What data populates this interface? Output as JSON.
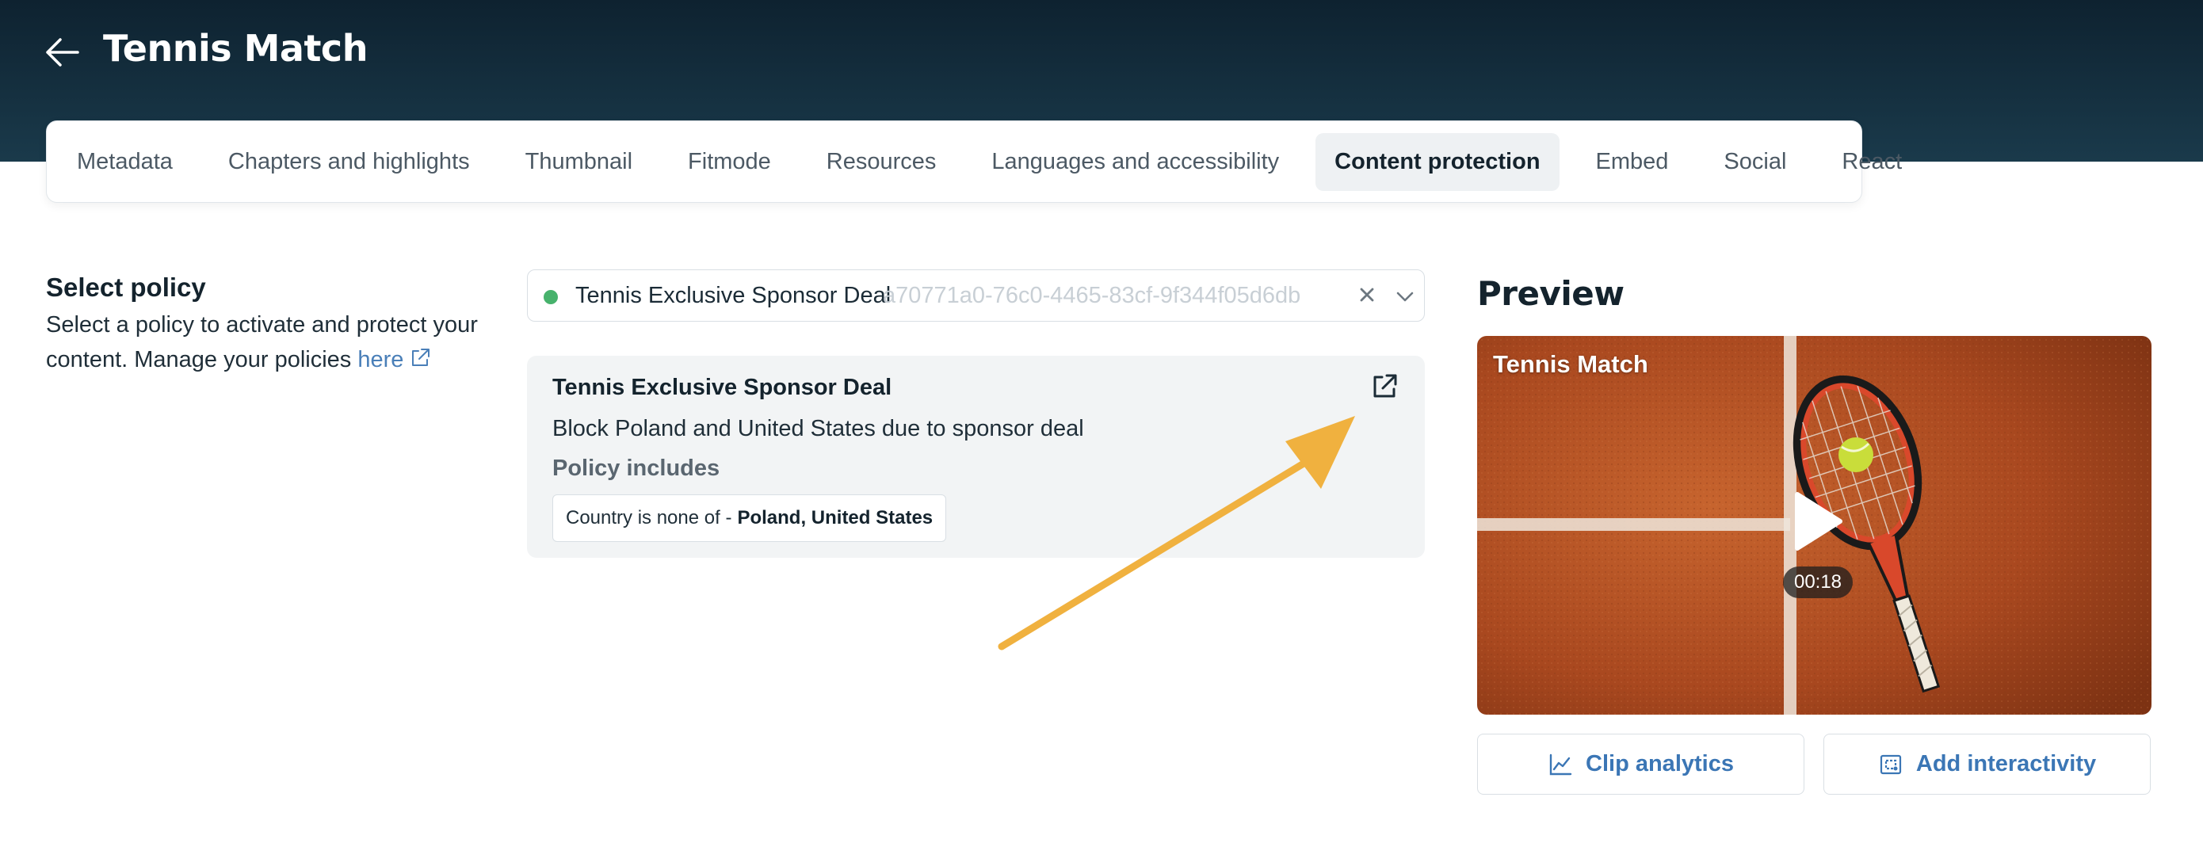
{
  "header": {
    "title": "Tennis Match",
    "back_icon": "arrow-left-icon"
  },
  "tabs": [
    {
      "label": "Metadata",
      "active": false
    },
    {
      "label": "Chapters and highlights",
      "active": false
    },
    {
      "label": "Thumbnail",
      "active": false
    },
    {
      "label": "Fitmode",
      "active": false
    },
    {
      "label": "Resources",
      "active": false
    },
    {
      "label": "Languages and accessibility",
      "active": false
    },
    {
      "label": "Content protection",
      "active": true
    },
    {
      "label": "Embed",
      "active": false
    },
    {
      "label": "Social",
      "active": false
    },
    {
      "label": "React",
      "active": false
    }
  ],
  "select_policy": {
    "title": "Select policy",
    "description": "Select a policy to activate and protect your content. Manage your policies",
    "link_text": "here",
    "link_icon": "external-link-icon"
  },
  "policy_select": {
    "selected_name": "Tennis Exclusive Sponsor Deal",
    "selected_id": "a70771a0-76c0-4465-83cf-9f344f05d6db",
    "status_color": "#47b26c",
    "clear_icon": "close-icon",
    "dropdown_icon": "chevron-down-icon"
  },
  "policy_card": {
    "name": "Tennis Exclusive Sponsor Deal",
    "description": "Block Poland and United States due to sponsor deal",
    "includes_label": "Policy includes",
    "rule_prefix": "Country is none of -",
    "rule_values": "Poland, United States",
    "open_icon": "external-link-icon"
  },
  "annotation": {
    "arrow_color": "#f0b13f"
  },
  "preview": {
    "title": "Preview",
    "video_title": "Tennis Match",
    "duration": "00:18",
    "play_icon": "play-icon"
  },
  "actions": {
    "clip_analytics": "Clip analytics",
    "clip_analytics_icon": "line-chart-icon",
    "add_interactivity": "Add interactivity",
    "add_interactivity_icon": "interactivity-icon"
  },
  "colors": {
    "header_bg": "#13303f",
    "link": "#4a7fb8",
    "action": "#3b76b5"
  }
}
